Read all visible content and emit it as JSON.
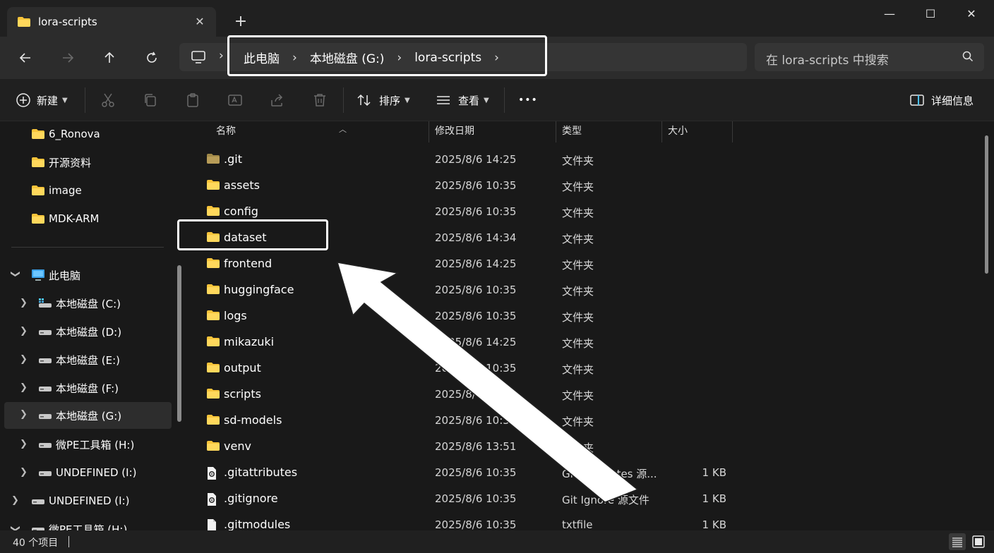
{
  "tab": {
    "title": "lora-scripts",
    "close_glyph": "✕",
    "new_tab_glyph": "+"
  },
  "window": {
    "minimize": "—",
    "maximize": "☐",
    "close": "✕"
  },
  "address": {
    "crumbs": [
      "此电脑",
      "本地磁盘 (G:)",
      "lora-scripts"
    ],
    "separator": "›"
  },
  "search": {
    "placeholder": "在 lora-scripts 中搜索"
  },
  "toolbar": {
    "new_label": "新建",
    "sort_label": "排序",
    "view_label": "查看",
    "more_label": "•••",
    "details_label": "详细信息"
  },
  "sidebar": {
    "quick": [
      "6_Ronova",
      "开源资料",
      "image",
      "MDK-ARM"
    ],
    "this_pc": "此电脑",
    "drives": [
      "本地磁盘 (C:)",
      "本地磁盘 (D:)",
      "本地磁盘 (E:)",
      "本地磁盘 (F:)",
      "本地磁盘 (G:)",
      "微PE工具箱 (H:)",
      "UNDEFINED (I:)"
    ],
    "extra": [
      "UNDEFINED (I:)",
      "微PE工具箱 (H:)"
    ]
  },
  "columns": {
    "name": "名称",
    "date": "修改日期",
    "type": "类型",
    "size": "大小"
  },
  "files": [
    {
      "name": ".git",
      "date": "2025/8/6 14:25",
      "type": "文件夹",
      "size": "",
      "kind": "folder-dim"
    },
    {
      "name": "assets",
      "date": "2025/8/6 10:35",
      "type": "文件夹",
      "size": "",
      "kind": "folder"
    },
    {
      "name": "config",
      "date": "2025/8/6 10:35",
      "type": "文件夹",
      "size": "",
      "kind": "folder"
    },
    {
      "name": "dataset",
      "date": "2025/8/6 14:34",
      "type": "文件夹",
      "size": "",
      "kind": "folder"
    },
    {
      "name": "frontend",
      "date": "2025/8/6 14:25",
      "type": "文件夹",
      "size": "",
      "kind": "folder"
    },
    {
      "name": "huggingface",
      "date": "2025/8/6 10:35",
      "type": "文件夹",
      "size": "",
      "kind": "folder"
    },
    {
      "name": "logs",
      "date": "2025/8/6 10:35",
      "type": "文件夹",
      "size": "",
      "kind": "folder"
    },
    {
      "name": "mikazuki",
      "date": "2025/8/6 14:25",
      "type": "文件夹",
      "size": "",
      "kind": "folder"
    },
    {
      "name": "output",
      "date": "2025/8/6 10:35",
      "type": "文件夹",
      "size": "",
      "kind": "folder"
    },
    {
      "name": "scripts",
      "date": "2025/8/6 10:35",
      "type": "文件夹",
      "size": "",
      "kind": "folder"
    },
    {
      "name": "sd-models",
      "date": "2025/8/6 10:35",
      "type": "文件夹",
      "size": "",
      "kind": "folder"
    },
    {
      "name": "venv",
      "date": "2025/8/6 13:51",
      "type": "文件夹",
      "size": "",
      "kind": "folder"
    },
    {
      "name": ".gitattributes",
      "date": "2025/8/6 10:35",
      "type": "Git Attributes 源...",
      "size": "1 KB",
      "kind": "gear-file"
    },
    {
      "name": ".gitignore",
      "date": "2025/8/6 10:35",
      "type": "Git Ignore 源文件",
      "size": "1 KB",
      "kind": "gear-file"
    },
    {
      "name": ".gitmodules",
      "date": "2025/8/6 10:35",
      "type": "txtfile",
      "size": "1 KB",
      "kind": "file"
    }
  ],
  "status": {
    "count": "40 个项目"
  },
  "colors": {
    "folder": "#f8c43a",
    "folder_dim": "#a08848",
    "accent": "#4cc2ff"
  }
}
